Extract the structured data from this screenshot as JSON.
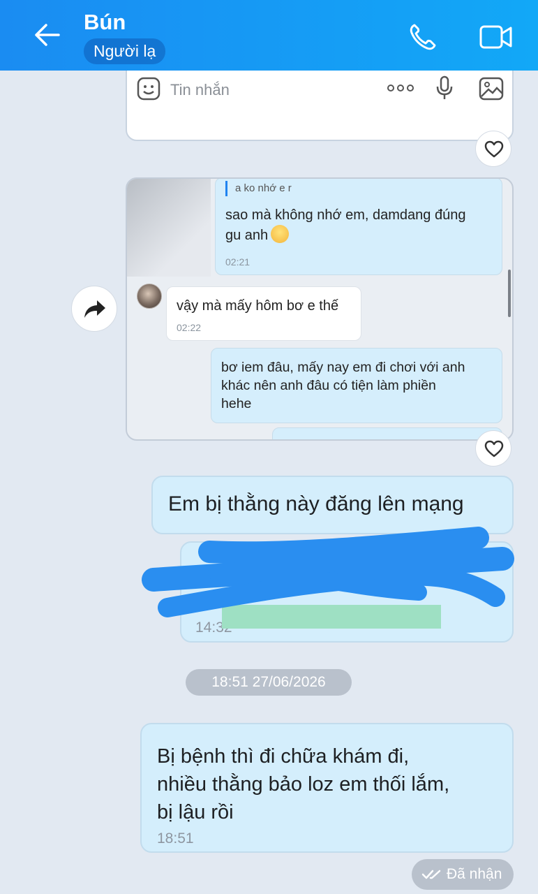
{
  "header": {
    "contact_name": "Bún",
    "stranger_label": "Người lạ"
  },
  "forwarded_screenshot": {
    "composer_placeholder": "Tin nhắn",
    "messages": [
      {
        "direction": "out",
        "quote": "a ko nhớ e r",
        "text_lines": [
          "sao mà không nhớ em, damdang đúng",
          "gu anh"
        ],
        "emoji": "smiling-face",
        "time": "02:21"
      },
      {
        "direction": "in",
        "text": "vậy mà mấy hôm bơ e thế",
        "time": "02:22"
      },
      {
        "direction": "out",
        "text_lines": [
          "bơ iem đâu, mấy nay em đi chơi với anh",
          "khác nên anh đâu có tiện làm phiền",
          "hehe"
        ]
      }
    ]
  },
  "messages": [
    {
      "text": "Em bị thằng này đăng lên mạng"
    },
    {
      "text": "",
      "time": "14:32",
      "note": ""
    },
    {
      "text_lines": [
        "Bị bệnh thì đi chữa khám đi,",
        "nhiều thằng bảo loz em thối lắm,",
        "bị lậu rồi"
      ],
      "time": "18:51"
    }
  ],
  "date_separator": "18:51 27/06/2026",
  "status": "Đã nhận",
  "colors": {
    "header_start": "#1a8cf2",
    "header_end": "#12a8f7",
    "outgoing_bubble": "#d4eefc",
    "background": "#e2e9f2",
    "redaction_scribble": "#2a8ef0"
  }
}
